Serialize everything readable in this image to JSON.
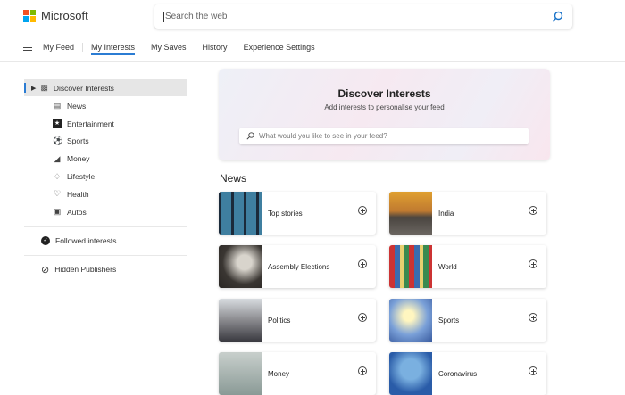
{
  "brand": {
    "name": "Microsoft",
    "colors": [
      "#f25022",
      "#7fba00",
      "#00a4ef",
      "#ffb900"
    ]
  },
  "search": {
    "placeholder": "Search the web"
  },
  "nav": {
    "items": [
      "My Feed",
      "My Interests",
      "My Saves",
      "History",
      "Experience Settings"
    ],
    "active": "My Interests"
  },
  "sidebar": {
    "discover": "Discover Interests",
    "items": [
      {
        "label": "News",
        "icon": "newspaper-icon"
      },
      {
        "label": "Entertainment",
        "icon": "star-icon"
      },
      {
        "label": "Sports",
        "icon": "ball-icon"
      },
      {
        "label": "Money",
        "icon": "chart-icon"
      },
      {
        "label": "Lifestyle",
        "icon": "diamond-icon"
      },
      {
        "label": "Health",
        "icon": "heart-icon"
      },
      {
        "label": "Autos",
        "icon": "car-icon"
      }
    ],
    "followed": "Followed interests",
    "hidden": "Hidden Publishers"
  },
  "banner": {
    "title": "Discover Interests",
    "subtitle": "Add interests to personalise your feed",
    "placeholder": "What would you like to see in your feed?"
  },
  "section": "News",
  "cards": [
    "Top stories",
    "India",
    "Assembly Elections",
    "World",
    "Politics",
    "Sports",
    "Money",
    "Coronavirus"
  ],
  "accent": "#2b7cd3"
}
